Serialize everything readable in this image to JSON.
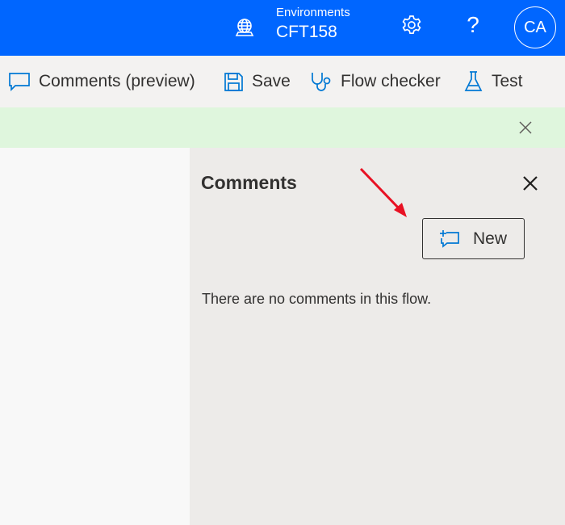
{
  "header": {
    "environment_label": "Environments",
    "environment_name": "CFT158",
    "help_glyph": "?",
    "avatar_initials": "CA",
    "background_color": "#0066ff",
    "icons": [
      "environment-globe-icon",
      "settings-gear-icon"
    ]
  },
  "toolbar": {
    "comments_label": "Comments (preview)",
    "save_label": "Save",
    "flow_checker_label": "Flow checker",
    "test_label": "Test",
    "accent_color": "#0078d4"
  },
  "notice": {
    "background_color": "#dff6dd"
  },
  "comments_panel": {
    "title": "Comments",
    "new_button_label": "New",
    "empty_message": "There are no comments in this flow."
  },
  "annotation": {
    "arrow_color": "#e81123",
    "points_to": "new-comment-button"
  }
}
